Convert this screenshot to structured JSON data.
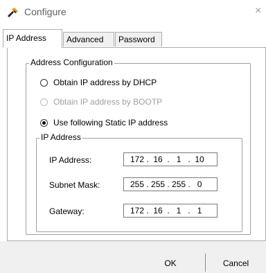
{
  "window": {
    "title": "Configure",
    "close_label": "×"
  },
  "tabs": [
    {
      "label": "IP Address",
      "active": true
    },
    {
      "label": "Advanced",
      "active": false
    },
    {
      "label": "Password",
      "active": false
    }
  ],
  "address_config": {
    "legend": "Address Configuration",
    "options": [
      {
        "label": "Obtain IP address by DHCP",
        "checked": false,
        "disabled": false
      },
      {
        "label": "Obtain IP address by BOOTP",
        "checked": false,
        "disabled": true
      },
      {
        "label": "Use following Static IP address",
        "checked": true,
        "disabled": false
      }
    ]
  },
  "ip_group": {
    "legend": "IP Address",
    "fields": [
      {
        "label": "IP Address:",
        "value": "172 .  16  .   1   .  10"
      },
      {
        "label": "Subnet Mask:",
        "value": "255 . 255 . 255 .   0"
      },
      {
        "label": "Gateway:",
        "value": "172 .  16  .   1   .   1"
      }
    ]
  },
  "buttons": {
    "ok": "OK",
    "cancel": "Cancel"
  },
  "colors": {
    "icon_dark": "#2b2b2b",
    "icon_accent": "#f0a020"
  },
  "icons": {
    "app": "tools-icon",
    "close": "close-icon"
  }
}
